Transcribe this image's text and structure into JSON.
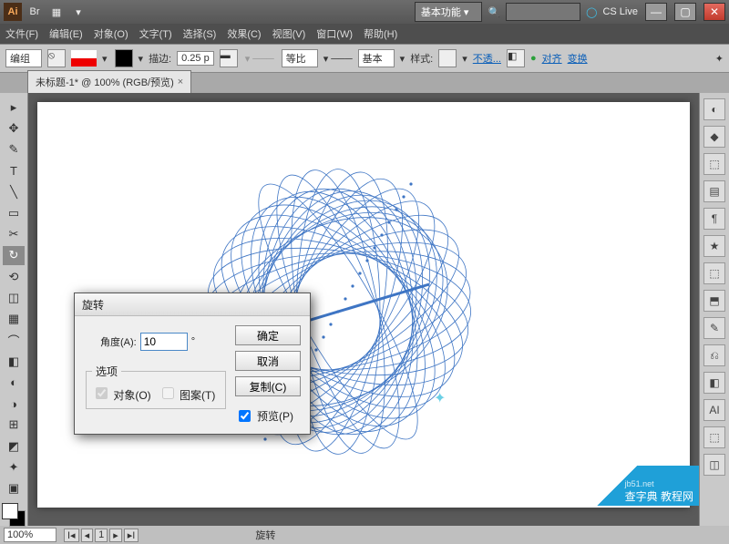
{
  "titlebar": {
    "app": "Ai",
    "workspace": "基本功能",
    "search_placeholder": "",
    "cslive": "CS Live",
    "icons": [
      "Br",
      "▦",
      "▾"
    ]
  },
  "menu": [
    "文件(F)",
    "编辑(E)",
    "对象(O)",
    "文字(T)",
    "选择(S)",
    "效果(C)",
    "视图(V)",
    "窗口(W)",
    "帮助(H)"
  ],
  "control": {
    "mode": "编组",
    "stroke_label": "描边:",
    "stroke": "0.25 p",
    "scale": "等比",
    "profile": "基本",
    "style_label": "样式:",
    "opacity": "不透...",
    "align": "对齐",
    "transform": "变换"
  },
  "tab": {
    "label": "未标题-1* @ 100% (RGB/预览)"
  },
  "tools": [
    "▸",
    "✥",
    "✎",
    "T",
    "╲",
    "▭",
    "✂",
    "↻",
    "⟲",
    "◫",
    "▦",
    "⌒",
    "◧",
    "◐",
    "◑",
    "⊞",
    "◩",
    "✦",
    "▣"
  ],
  "panels": [
    "◐",
    "◆",
    "⬚",
    "▤",
    "¶",
    "★",
    "⬚",
    "⬒",
    "✎",
    "⎌",
    "◧",
    "AI",
    "⬚",
    "◫"
  ],
  "dialog": {
    "title": "旋转",
    "angle_label": "角度(A):",
    "angle_value": "10",
    "angle_unit": "°",
    "options_legend": "选项",
    "opt_objects": "对象(O)",
    "opt_patterns": "图案(T)",
    "ok": "确定",
    "cancel": "取消",
    "copy": "复制(C)",
    "preview": "预览(P)"
  },
  "status": {
    "zoom": "100%",
    "section": "旋转"
  },
  "watermark": {
    "site": "查字典  教程网",
    "url": "jb51.net"
  }
}
